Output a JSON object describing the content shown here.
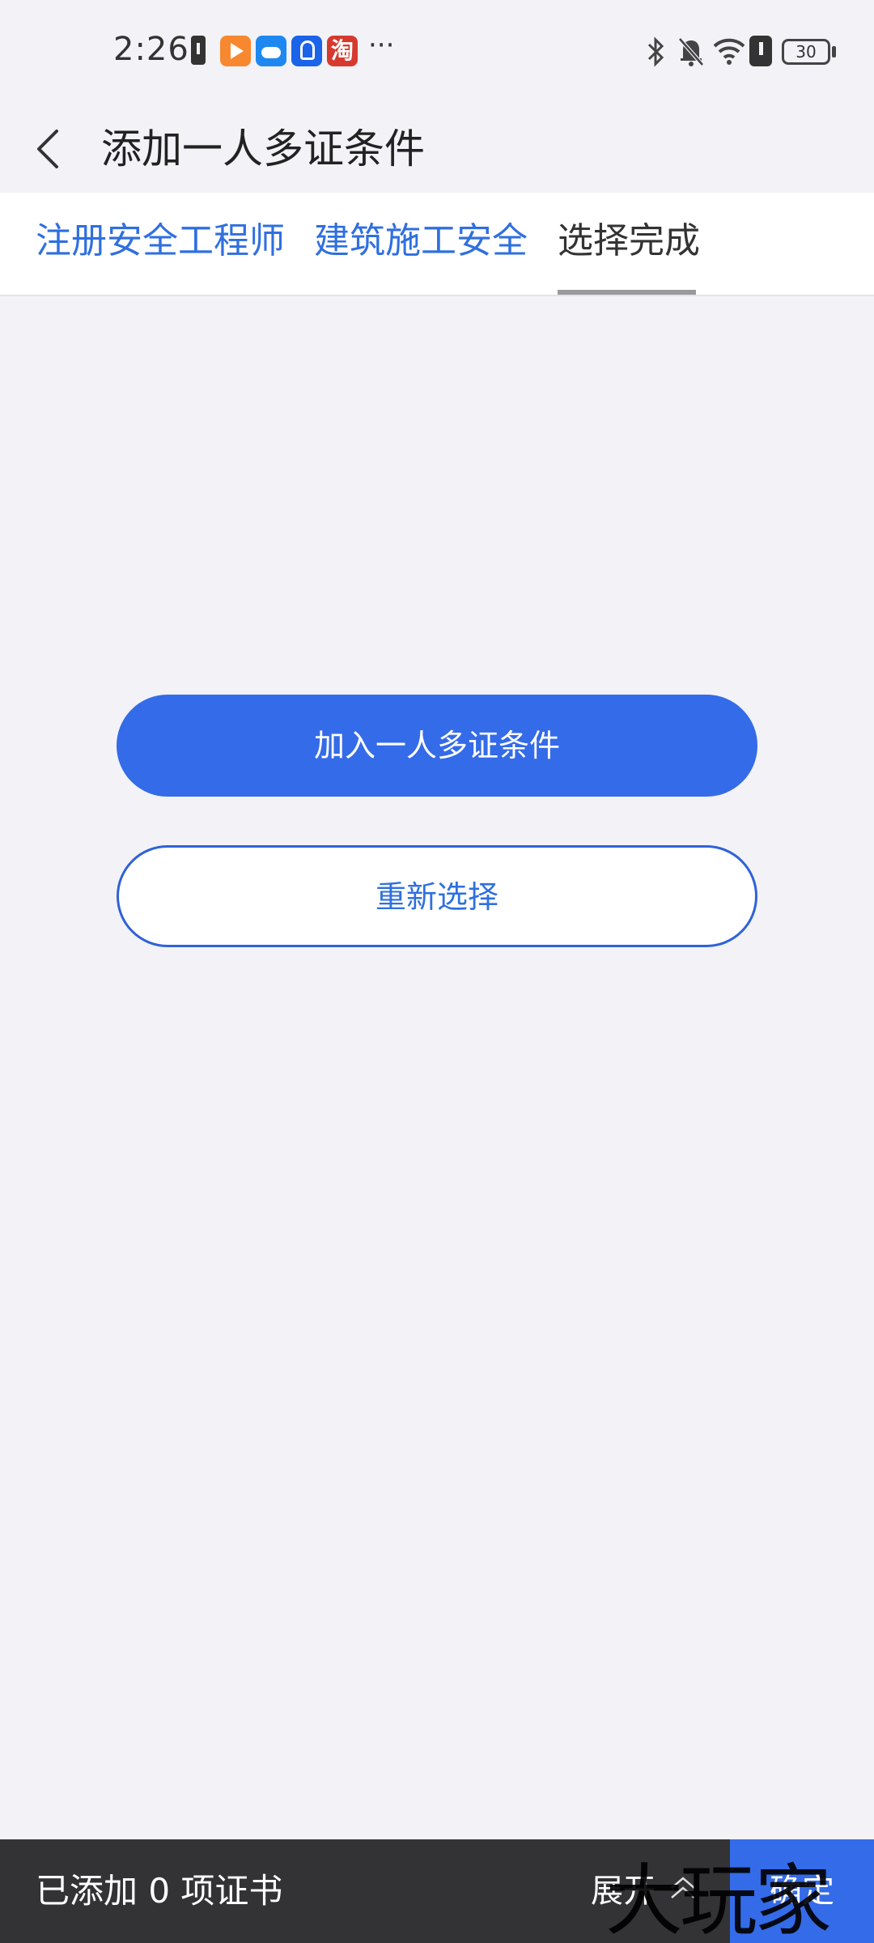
{
  "status_bar": {
    "time": "2:26",
    "more": "···",
    "battery": "30",
    "taobao_glyph": "淘"
  },
  "header": {
    "title": "添加一人多证条件"
  },
  "tabs": [
    {
      "label": "注册安全工程师"
    },
    {
      "label": "建筑施工安全"
    },
    {
      "label": "选择完成"
    }
  ],
  "actions": {
    "primary_label": "加入一人多证条件",
    "secondary_label": "重新选择"
  },
  "bottom_bar": {
    "added_text": "已添加 0 项证书",
    "expand_label": "展开",
    "confirm_label": "确定"
  },
  "watermark": "大玩家",
  "colors": {
    "accent": "#346be8",
    "tab_text_blue": "#2f6fe0",
    "bottom_bar_bg": "#333336",
    "page_bg": "#f2f2f7"
  }
}
